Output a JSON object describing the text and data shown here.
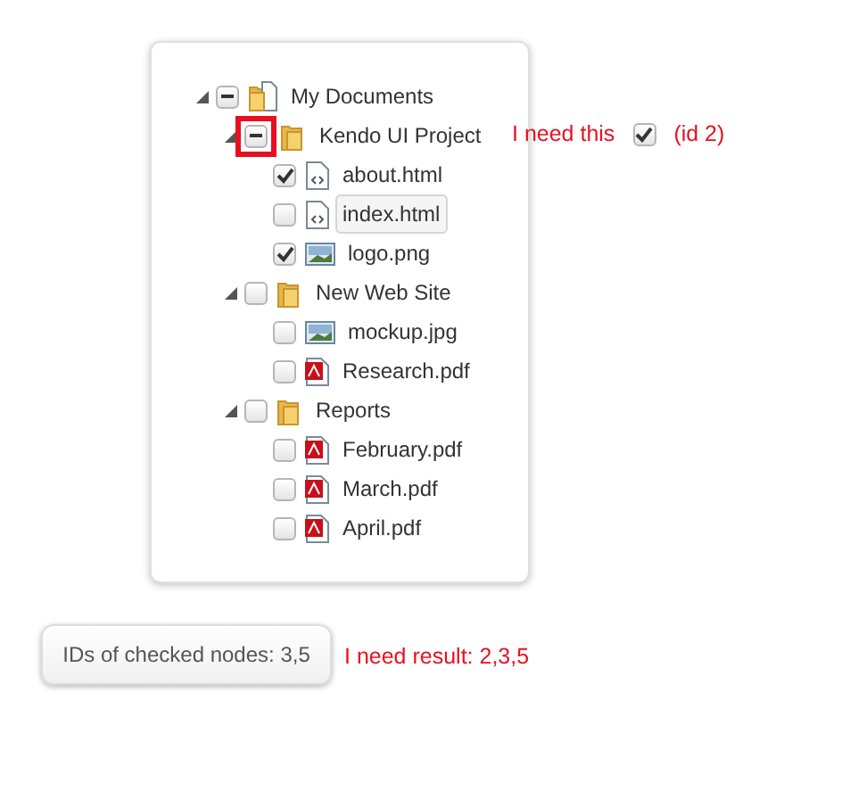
{
  "tree": [
    {
      "label": "My Documents",
      "kind": "folder-documents",
      "expanded": true,
      "indeterminate": true,
      "focused": false,
      "children": [
        {
          "label": "Kendo UI Project",
          "kind": "folder",
          "expanded": true,
          "indeterminate": true,
          "highlighted": true,
          "focused": false,
          "children": [
            {
              "label": "about.html",
              "kind": "html",
              "checked": true,
              "focused": false
            },
            {
              "label": "index.html",
              "kind": "html",
              "checked": false,
              "focused": true
            },
            {
              "label": "logo.png",
              "kind": "image",
              "checked": true,
              "focused": false
            }
          ]
        },
        {
          "label": "New Web Site",
          "kind": "folder",
          "expanded": true,
          "checked": false,
          "focused": false,
          "children": [
            {
              "label": "mockup.jpg",
              "kind": "image",
              "checked": false,
              "focused": false
            },
            {
              "label": "Research.pdf",
              "kind": "pdf",
              "checked": false,
              "focused": false
            }
          ]
        },
        {
          "label": "Reports",
          "kind": "folder",
          "expanded": true,
          "checked": false,
          "focused": false,
          "children": [
            {
              "label": "February.pdf",
              "kind": "pdf",
              "checked": false,
              "focused": false
            },
            {
              "label": "March.pdf",
              "kind": "pdf",
              "checked": false,
              "focused": false
            },
            {
              "label": "April.pdf",
              "kind": "pdf",
              "checked": false,
              "focused": false
            }
          ]
        }
      ]
    }
  ],
  "annotation": {
    "note": "I need this",
    "checked": true,
    "id_note": "(id 2)"
  },
  "result_button": {
    "label": "IDs of checked nodes: 3,5"
  },
  "result_note": "I need result: 2,3,5"
}
